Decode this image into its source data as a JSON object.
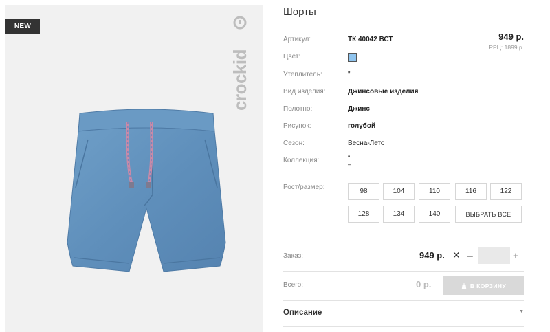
{
  "badge": "NEW",
  "brand": "crockid",
  "product": {
    "title": "Шорты",
    "price": "949 р.",
    "rrc": "РРЦ: 1899 р.",
    "color_hex": "#8fc4ee"
  },
  "properties": [
    {
      "label": "Артикул:",
      "value": "ТК 40042 ВСТ"
    },
    {
      "label": "Цвет:",
      "value": ""
    },
    {
      "label": "Утеплитель:",
      "value": "\""
    },
    {
      "label": "Вид изделия:",
      "value": "Джинсовые изделия"
    },
    {
      "label": "Полотно:",
      "value": "Джинс"
    },
    {
      "label": "Рисунок:",
      "value": "голубой"
    },
    {
      "label": "Сезон:",
      "value": "Весна-Лето"
    },
    {
      "label": "Коллекция:",
      "value": "\"\n–"
    }
  ],
  "sizes": {
    "label": "Рост/размер:",
    "options": [
      "98",
      "104",
      "110",
      "116",
      "122",
      "128",
      "134",
      "140"
    ],
    "select_all": "ВЫБРАТЬ ВСЕ"
  },
  "order": {
    "label": "Заказ:",
    "price": "949 р.",
    "times": "✕",
    "minus": "–",
    "plus": "+",
    "qty": ""
  },
  "total": {
    "label": "Всего:",
    "value": "0 р.",
    "cart_button": "В КОРЗИНУ"
  },
  "description": {
    "label": "Описание",
    "chevron": "▼"
  }
}
